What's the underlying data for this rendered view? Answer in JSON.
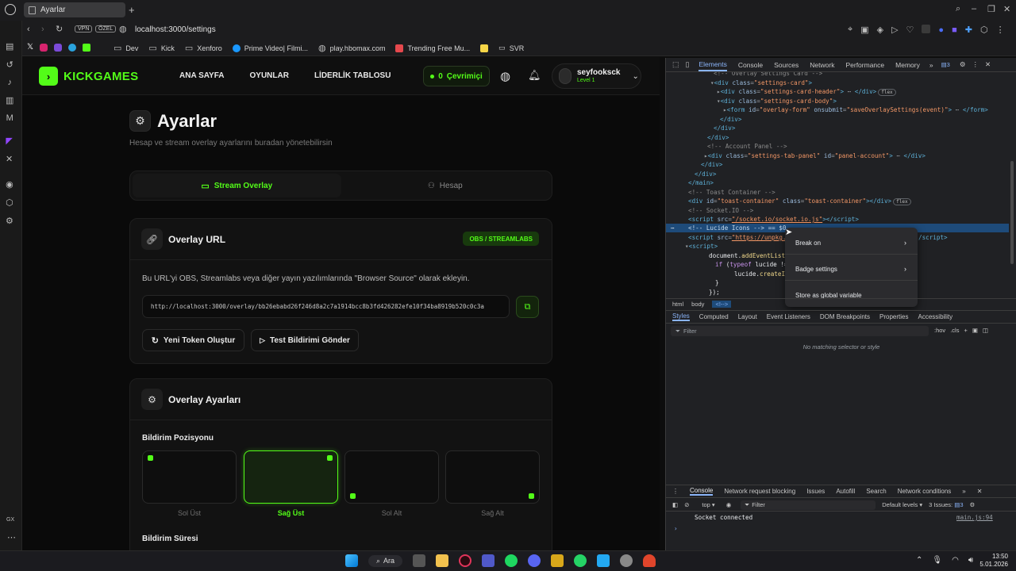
{
  "browser": {
    "tab_title": "Ayarlar",
    "url": "localhost:3000/settings",
    "vpn_badge": "VPN",
    "private_badge": "ÖZEL",
    "bookmarks": [
      "Dev",
      "Kick",
      "Xenforo",
      "Prime Video| Filmi...",
      "play.hbomax.com",
      "Trending Free Mu...",
      "SVR"
    ],
    "sidebar_bottom": "GX"
  },
  "site": {
    "logo": "KICKGAMES",
    "nav": [
      "ANA SAYFA",
      "OYUNLAR",
      "LİDERLİK TABLOSU"
    ],
    "online_count": "0",
    "online_label": "Çevrimiçi",
    "user_name": "seyfooksck",
    "user_level": "Level 1",
    "page_title": "Ayarlar",
    "page_subtitle": "Hesap ve stream overlay ayarlarını buradan yönetebilirsin",
    "tabs": [
      "Stream Overlay",
      "Hesap"
    ],
    "overlay_url_card": {
      "title": "Overlay URL",
      "badge": "OBS / STREAMLABS",
      "desc": "Bu URL'yi OBS, Streamlabs veya diğer yayın yazılımlarında \"Browser Source\" olarak ekleyin.",
      "url": "http://localhost:3000/overlay/bb26ebabd26f246d8a2c7a1914bcc8b3fd426282efe10f34ba8919b520c0c3a",
      "btn_token": "Yeni Token Oluştur",
      "btn_test": "Test Bildirimi Gönder"
    },
    "overlay_settings_card": {
      "title": "Overlay Ayarları",
      "position_label": "Bildirim Pozisyonu",
      "positions": [
        "Sol Üst",
        "Sağ Üst",
        "Sol Alt",
        "Sağ Alt"
      ],
      "selected_position": "Sağ Üst",
      "duration_label": "Bildirim Süresi"
    },
    "accent": "#53fc18"
  },
  "devtools": {
    "tabs": [
      "Elements",
      "Console",
      "Sources",
      "Network",
      "Performance",
      "Memory"
    ],
    "issues_count": "3",
    "breadcrumb": [
      "html",
      "body",
      "<!-->"
    ],
    "styles_tabs": [
      "Styles",
      "Computed",
      "Layout",
      "Event Listeners",
      "DOM Breakpoints",
      "Properties",
      "Accessibility"
    ],
    "filter_placeholder": "Filter",
    "hov": ":hov",
    "cls": ".cls",
    "no_match": "No matching selector or style",
    "context_menu": [
      "Break on",
      "Badge settings",
      "Store as global variable"
    ],
    "drawer_tabs": [
      "Console",
      "Network request blocking",
      "Issues",
      "Autofill",
      "Search",
      "Network conditions"
    ],
    "console_context": "top",
    "console_filter": "Filter",
    "default_levels": "Default levels",
    "console_issues": "3 Issues:",
    "console_issues_count": "3",
    "console_message": "Socket connected",
    "console_source": "main.js:94"
  },
  "taskbar": {
    "search": "Ara",
    "time": "13:50",
    "date": "5.01.2026"
  }
}
